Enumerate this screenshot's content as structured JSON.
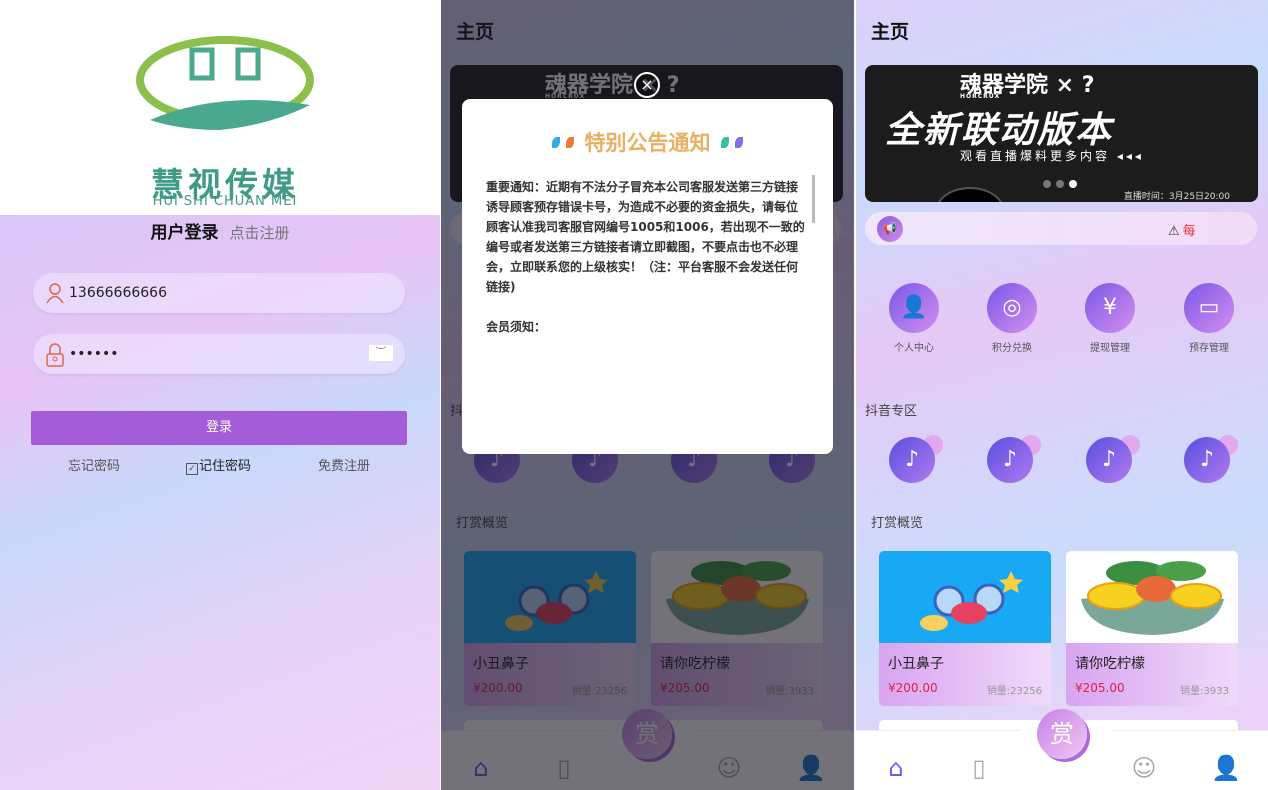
{
  "login": {
    "logo_text": "慧视传媒",
    "logo_sub": "HUI SHI CHUAN MEI",
    "title": "用户登录",
    "register_tab": "点击注册",
    "username": "13666666666",
    "password": "••••••",
    "login_button": "登录",
    "forgot": "忘记密码",
    "remember": "记住密码",
    "remember_checked": true,
    "free_register": "免费注册"
  },
  "home": {
    "title": "主页",
    "banner": {
      "brand": "魂器学院 × ?",
      "brand_en": "HORCRUX",
      "headline": "全新联动版本",
      "subline": "观看直播爆料更多内容 ◂◂◂",
      "time": "直播时间：3月25日20:00",
      "active_slide": 3,
      "slides": 3
    },
    "notice": {
      "text": "每",
      "icon": "warning-icon"
    },
    "menu": [
      {
        "label": "个人中心",
        "icon": "user-check-icon"
      },
      {
        "label": "积分兑换",
        "icon": "coins-icon"
      },
      {
        "label": "提现管理",
        "icon": "yen-house-icon"
      },
      {
        "label": "预存管理",
        "icon": "wallet-icon"
      }
    ],
    "douyin_section": "抖音专区",
    "reward_section": "打赏概览",
    "cards": [
      {
        "name": "小丑鼻子",
        "price": "¥200.00",
        "sales": "销量:23256"
      },
      {
        "name": "请你吃柠檬",
        "price": "¥205.00",
        "sales": "销量:3933"
      }
    ],
    "nav": {
      "center": "赏",
      "items": [
        "home-icon",
        "orders-icon",
        "reward-icon",
        "support-icon",
        "profile-icon"
      ],
      "active": "home-icon"
    }
  },
  "modal": {
    "title": "特别公告通知",
    "paragraphs": [
      "重要通知：近期有不法分子冒充本公司客服发送第三方链接诱导顾客预存错误卡号，为造成不必要的资金损失，请每位顾客认准我司客服官网编号1005和1006，若出现不一致的编号或者发送第三方链接者请立即截图，不要点击也不必理会，立即联系您的上级核实！（注：平台客服不会发送任何链接)",
      "会员须知："
    ]
  },
  "colors": {
    "primary": "#a45cd8",
    "price": "#e0204a",
    "logo": "#3f9a86"
  }
}
